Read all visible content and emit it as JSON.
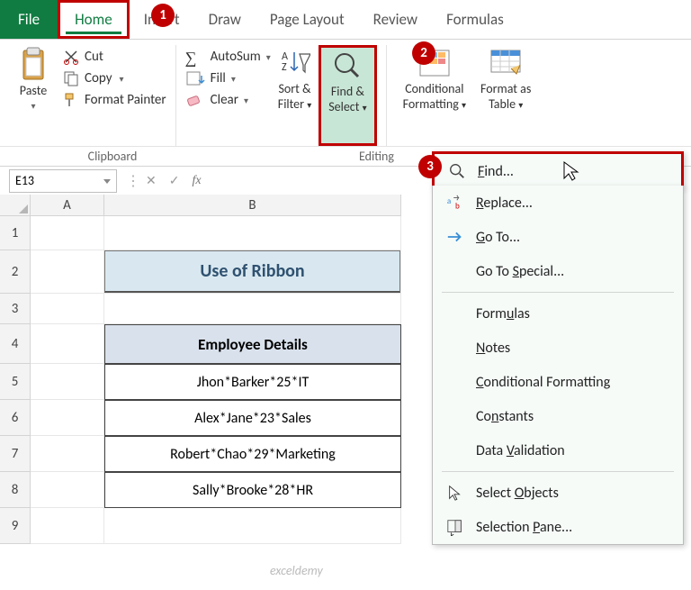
{
  "tabs": {
    "file": "File",
    "home": "Home",
    "insert": "Insert",
    "draw": "Draw",
    "page_layout": "Page Layout",
    "review": "Review",
    "formulas": "Formulas"
  },
  "ribbon": {
    "paste_label": "Paste",
    "cut_label": "Cut",
    "copy_label": "Copy",
    "format_painter_label": "Format Painter",
    "clipboard_group": "Clipboard",
    "autosum_label": "AutoSum",
    "fill_label": "Fill",
    "clear_label": "Clear",
    "editing_group": "Editing",
    "sort_filter_label1": "Sort &",
    "sort_filter_label2": "Filter",
    "find_select_label1": "Find &",
    "find_select_label2": "Select",
    "cond_fmt_label1": "Conditional",
    "cond_fmt_label2": "Formatting",
    "fmt_table_label1": "Format as",
    "fmt_table_label2": "Table"
  },
  "callouts": {
    "c1": "1",
    "c2": "2",
    "c3": "3"
  },
  "namebox": "E13",
  "columns": {
    "A": "A",
    "B": "B"
  },
  "rows": [
    "1",
    "2",
    "3",
    "4",
    "5",
    "6",
    "7",
    "8",
    "9"
  ],
  "sheet": {
    "title": "Use of Ribbon",
    "header": "Employee Details",
    "data": [
      "Jhon*Barker*25*IT",
      "Alex*Jane*23*Sales",
      "Robert*Chao*29*Marketing",
      "Sally*Brooke*28*HR"
    ]
  },
  "dropdown": {
    "find": "Find...",
    "replace": "Replace...",
    "goto": "Go To...",
    "goto_special": "Go To Special...",
    "formulas": "Formulas",
    "notes": "Notes",
    "cond_fmt": "Conditional Formatting",
    "constants": "Constants",
    "data_val": "Data Validation",
    "sel_obj": "Select Objects",
    "sel_pane": "Selection Pane..."
  },
  "watermark": "exceldemy"
}
